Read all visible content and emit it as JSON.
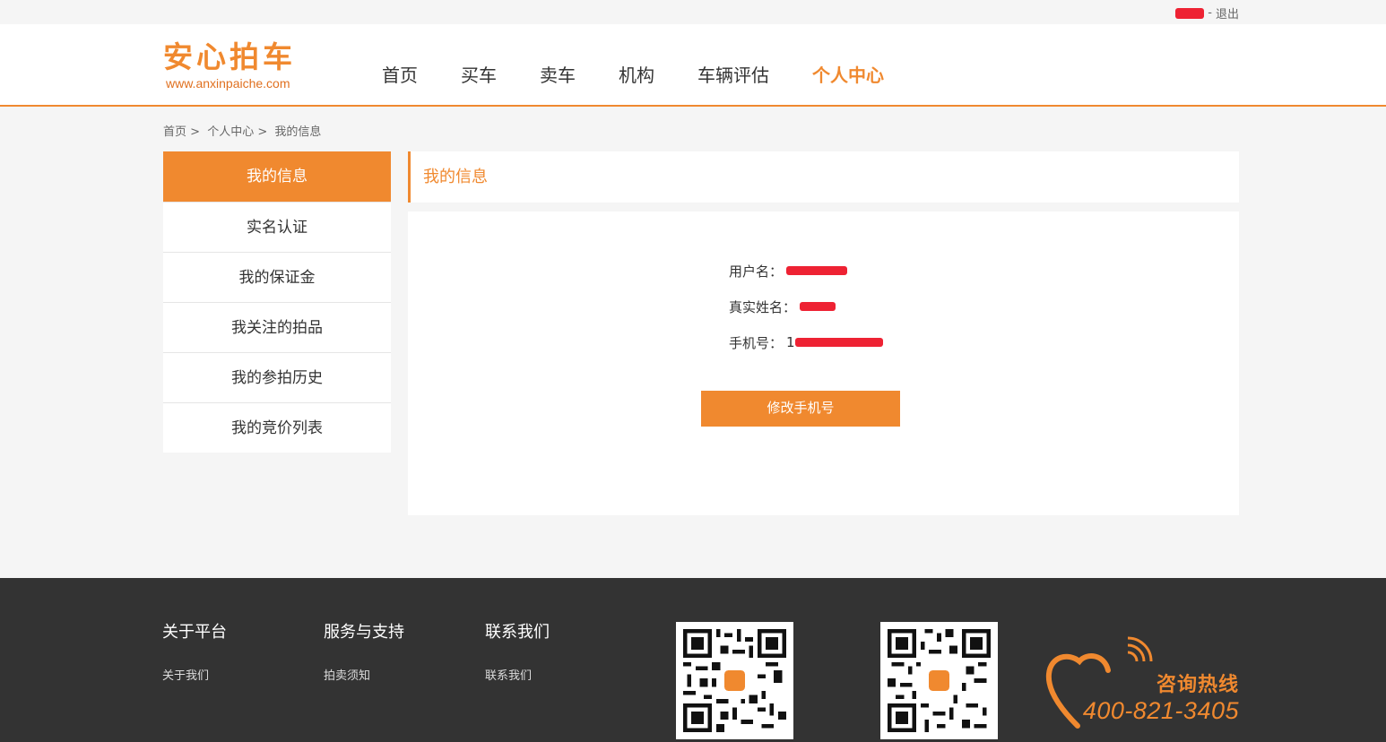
{
  "topbar": {
    "separator": "-",
    "logout": "退出"
  },
  "brand": {
    "name": "安心拍车",
    "url": "www.anxinpaiche.com",
    "accent": "#f0892f"
  },
  "nav": [
    {
      "label": "首页"
    },
    {
      "label": "买车"
    },
    {
      "label": "卖车"
    },
    {
      "label": "机构"
    },
    {
      "label": "车辆评估"
    },
    {
      "label": "个人中心",
      "active": true
    }
  ],
  "breadcrumb": [
    "首页",
    ">",
    "个人中心",
    ">",
    "我的信息"
  ],
  "sidebar": [
    {
      "label": "我的信息",
      "active": true
    },
    {
      "label": "实名认证"
    },
    {
      "label": "我的保证金"
    },
    {
      "label": "我关注的拍品"
    },
    {
      "label": "我的参拍历史"
    },
    {
      "label": "我的竞价列表"
    }
  ],
  "content": {
    "title": "我的信息",
    "fields": [
      {
        "label": "用户名：",
        "value": ""
      },
      {
        "label": "真实姓名：",
        "value": ""
      },
      {
        "label": "手机号：",
        "value": "1"
      }
    ],
    "change_phone_button": "修改手机号"
  },
  "footer": {
    "columns": [
      {
        "title": "关于平台",
        "link": "关于我们"
      },
      {
        "title": "服务与支持",
        "link": "拍卖须知"
      },
      {
        "title": "联系我们",
        "link": "联系我们"
      }
    ],
    "hotline_label": "咨询热线",
    "hotline_number": "400-821-3405"
  }
}
